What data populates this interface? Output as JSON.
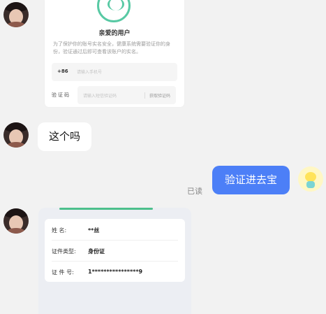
{
  "form_card": {
    "title": "亲爱的用户",
    "description": "为了保护你的账号实名安全，健康系统需要验证你的身份，验证通过后即可查看该账户的实名。",
    "country_code": "+86",
    "phone_placeholder": "请输入手机号",
    "code_label": "验证码",
    "code_placeholder": "请输入短信验证码",
    "get_code_label": "获取验证码"
  },
  "message_left": "这个吗",
  "message_right": "验证进去宝",
  "read_status": "已读",
  "id_card": {
    "rows": [
      {
        "label": "姓      名:",
        "value": "**丝"
      },
      {
        "label": "证件类型:",
        "value": "身份证"
      },
      {
        "label": "证  件  号:",
        "value": "1****************9"
      }
    ]
  },
  "colors": {
    "background": "#f2f2f2",
    "bubble_right": "#4c7ff7",
    "accent_green": "#4dc08c"
  }
}
